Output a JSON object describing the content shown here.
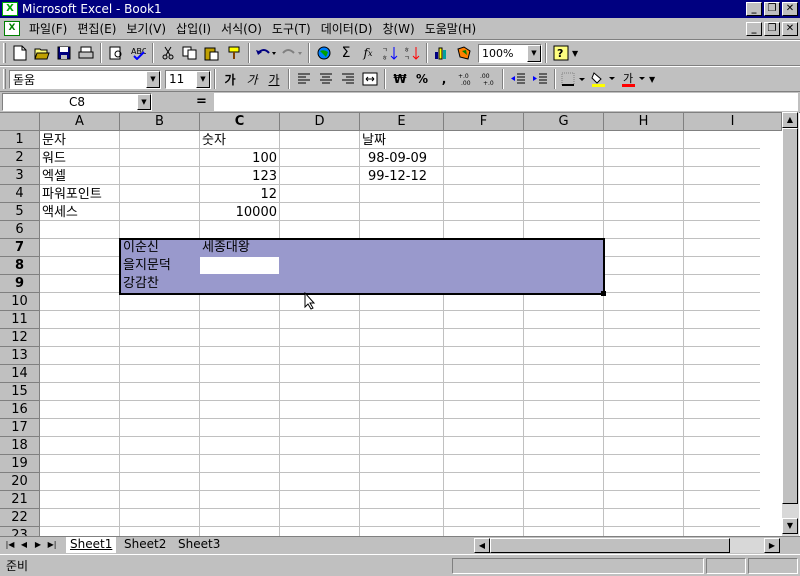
{
  "window": {
    "title": "Microsoft Excel - Book1",
    "app_icon": "excel-icon",
    "controls": [
      "_",
      "❐",
      "✕"
    ]
  },
  "menu": {
    "items": [
      "파일(F)",
      "편집(E)",
      "보기(V)",
      "삽입(I)",
      "서식(O)",
      "도구(T)",
      "데이터(D)",
      "창(W)",
      "도움말(H)"
    ]
  },
  "toolbar": {
    "zoom": "100%",
    "font_name": "돋움",
    "font_size": "11",
    "icons": [
      "new-icon",
      "open-icon",
      "save-icon",
      "print-icon",
      "print-preview-icon",
      "spelling-icon",
      "cut-icon",
      "copy-icon",
      "paste-icon",
      "format-painter-icon",
      "undo-icon",
      "redo-icon",
      "web-icon",
      "autosum-icon",
      "function-icon",
      "sort-asc-icon",
      "sort-desc-icon",
      "chart-wizard-icon",
      "map-icon",
      "help-icon"
    ],
    "format_labels": [
      "가",
      "가",
      "가",
      "₩",
      "%",
      ","
    ]
  },
  "formula": {
    "name_box": "C8",
    "equals": "=",
    "content": ""
  },
  "columns": [
    "A",
    "B",
    "C",
    "D",
    "E",
    "F",
    "G",
    "H",
    "I"
  ],
  "rows": [
    "1",
    "2",
    "3",
    "4",
    "5",
    "6",
    "7",
    "8",
    "9",
    "10",
    "11",
    "12",
    "13",
    "14",
    "15",
    "16",
    "17",
    "18",
    "19",
    "20",
    "21",
    "22",
    "23"
  ],
  "cells": {
    "A1": "문자",
    "A2": "워드",
    "A3": "엑셀",
    "A4": "파워포인트",
    "A5": "액세스",
    "C1": "숫자",
    "C2": "100",
    "C3": "123",
    "C4": "12",
    "C5": "10000",
    "E1": "날짜",
    "E2": "98-09-09",
    "E3": "99-12-12",
    "B7": "이순신",
    "C7": "세종대왕",
    "B8": "을지문덕",
    "B9": "강감찬"
  },
  "colors": {
    "title_bg": "#000080",
    "selection_fill": "#9999cc"
  },
  "sheets": {
    "tabs": [
      "Sheet1",
      "Sheet2",
      "Sheet3"
    ],
    "active": "Sheet1"
  },
  "status": {
    "text": "준비"
  }
}
